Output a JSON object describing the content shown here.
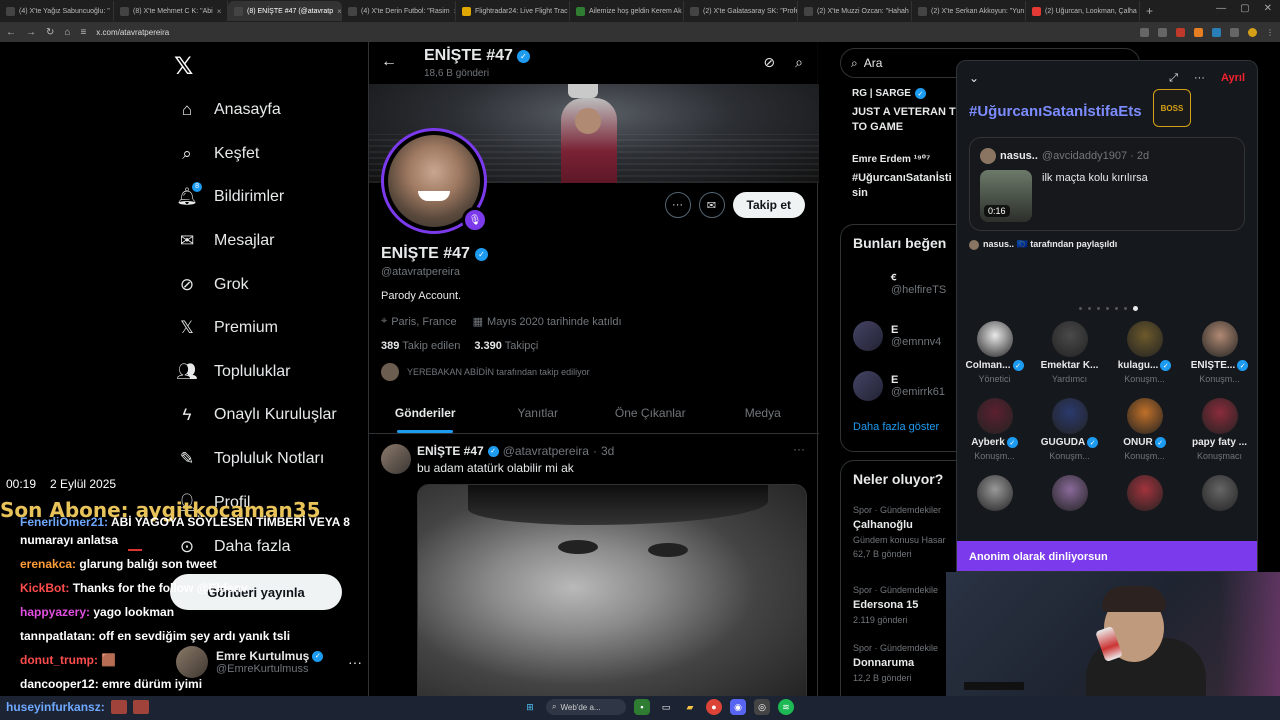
{
  "browser": {
    "tabs": [
      {
        "label": "(4) X'te Yağız Sabuncuoğlu: \"",
        "color": "#444"
      },
      {
        "label": "(8) X'te Mehmet C K: \"Abi",
        "color": "#444"
      },
      {
        "label": "(8) ENİŞTE #47 (@atavratp",
        "color": "#444",
        "active": true
      },
      {
        "label": "(4) X'te Derin Futbol: \"Rasim",
        "color": "#444"
      },
      {
        "label": "Flightradar24: Live Flight Trac",
        "color": "#e0a800"
      },
      {
        "label": "Ailemize hoş geldin Kerem Ak",
        "color": "#2e7d32"
      },
      {
        "label": "(2) X'te Galatasaray SK: \"Profe",
        "color": "#444"
      },
      {
        "label": "(2) X'te Muzzi Ozcan: \"Hahah",
        "color": "#444"
      },
      {
        "label": "(2) X'te Serkan Akkoyun: \"Yun",
        "color": "#444"
      },
      {
        "label": "(2) Uğurcan, Lookman, Çalha",
        "color": "#e53935"
      }
    ],
    "url": "x.com/atavratpereira"
  },
  "nav": {
    "items": [
      {
        "label": "Anasayfa",
        "icon": "home-icon"
      },
      {
        "label": "Keşfet",
        "icon": "search-icon"
      },
      {
        "label": "Bildirimler",
        "icon": "bell-icon",
        "badge": "8"
      },
      {
        "label": "Mesajlar",
        "icon": "mail-icon"
      },
      {
        "label": "Grok",
        "icon": "grok-icon"
      },
      {
        "label": "Premium",
        "icon": "x-icon"
      },
      {
        "label": "Topluluklar",
        "icon": "people-icon"
      },
      {
        "label": "Onaylı Kuruluşlar",
        "icon": "bolt-icon"
      },
      {
        "label": "Topluluk Notları",
        "icon": "notes-icon"
      },
      {
        "label": "Profil",
        "icon": "user-icon"
      },
      {
        "label": "Daha fazla",
        "icon": "more-circle-icon"
      }
    ],
    "post_button": "Gönderi yayınla",
    "account": {
      "name": "Emre Kurtulmuş",
      "handle": "@EmreKurtulmuss"
    }
  },
  "profile": {
    "header_name": "ENİŞTE #47",
    "post_count": "18,6 B gönderi",
    "name": "ENİŞTE #47",
    "handle": "@atavratpereira",
    "bio": "Parody Account.",
    "location": "Paris, France",
    "joined": "Mayıs 2020 tarihinde katıldı",
    "following_count": "389",
    "following_label": "Takip edilen",
    "followers_count": "3.390",
    "followers_label": "Takipçi",
    "followed_by": "YEREBAKAN ABİDİN tarafından takip ediliyor",
    "follow_button": "Takip et",
    "tabs": [
      "Gönderiler",
      "Yanıtlar",
      "Öne Çıkanlar",
      "Medya"
    ]
  },
  "tweet": {
    "name": "ENİŞTE #47",
    "handle": "@atavratpereira",
    "time": "3d",
    "text": "bu adam atatürk olabilir mi ak"
  },
  "right": {
    "search_placeholder": "Ara",
    "post1": {
      "author": "RG | SARGE",
      "text": "JUST A VETERAN TI",
      "text2": "TO GAME"
    },
    "post2": {
      "author": "Emre Erdem ¹⁹⁰⁷",
      "text": "#UğurcanıSatanİsti",
      "text2": "sin"
    },
    "suggest_title": "Bunları beğen",
    "suggestions": [
      {
        "name": "ꞓ",
        "handle": "@helfireTS"
      },
      {
        "name": "E",
        "handle": "@emnnv4"
      },
      {
        "name": "E",
        "handle": "@emirrk61"
      }
    ],
    "show_more": "Daha fazla göster",
    "trends_title": "Neler oluyor?",
    "trends": [
      {
        "category": "Spor · Gündemdekiler",
        "title": "Çalhanoğlu",
        "count": "Gündem konusu  Hasar",
        "count2": "62,7 B gönderi"
      },
      {
        "category": "Spor · Gündemdekile",
        "title": "Edersona 15",
        "count": "2.119 gönderi"
      },
      {
        "category": "Spor · Gündemdekile",
        "title": "Donnaruma",
        "count": "12,2 B gönderi"
      }
    ]
  },
  "space": {
    "leave": "Ayrıl",
    "title": "#UğurcanıSatanİstifaEts",
    "boss_logo": "BOSS",
    "card": {
      "name": "nasus..",
      "handle": "@avcidaddy1907 · 2d",
      "text": "ilk maçta kolu kırılırsa",
      "duration": "0:16"
    },
    "shared_by": "nasus.. 🇪🇺 tarafından paylaşıldı",
    "speakers": [
      {
        "name": "Colman...",
        "role": "Yönetici",
        "color": "#e8e8e8",
        "verified": true
      },
      {
        "name": "Emektar K...",
        "role": "Yardımcı",
        "color": "#4a4a4a",
        "verified": false
      },
      {
        "name": "kulagu...",
        "role": "Konuşm...",
        "color": "#6d5a2b",
        "verified": true
      },
      {
        "name": "ENİŞTE...",
        "role": "Konuşm...",
        "color": "#b08a73",
        "verified": true
      },
      {
        "name": "Ayberk",
        "role": "Konuşm...",
        "color": "#5c2030",
        "verified": true
      },
      {
        "name": "GUGUDA",
        "role": "Konuşm...",
        "color": "#2b3a6e",
        "verified": true
      },
      {
        "name": "ONUR",
        "role": "Konuşm...",
        "color": "#c07028",
        "verified": true
      },
      {
        "name": "papy faty ...",
        "role": "Konuşmacı",
        "color": "#8b2b3b",
        "verified": false
      },
      {
        "name": "",
        "role": "",
        "color": "#999",
        "verified": false
      },
      {
        "name": "",
        "role": "",
        "color": "#8a6a9a",
        "verified": false
      },
      {
        "name": "",
        "role": "",
        "color": "#a3333d",
        "verified": false
      },
      {
        "name": "",
        "role": "",
        "color": "#666",
        "verified": false
      }
    ],
    "banner": "Anonim olarak dinliyorsun"
  },
  "overlay": {
    "time": "00:19",
    "date": "2 Eylül 2025",
    "last_sub": "Son Abone: aygitkocaman35",
    "chat": [
      {
        "user": "FenerliOmer21:",
        "color": "#6fa8ff",
        "text": "ABİ YAGOYA SÖYLESEN TİMBERİ VEYA 8"
      },
      {
        "user": "",
        "color": "#fff",
        "text": "numarayı anlatsa"
      },
      {
        "user": "erenakca:",
        "color": "#ff9d3a",
        "text": "glarung balığı son tweet"
      },
      {
        "user": "KickBot:",
        "color": "#ff4d4d",
        "text": "Thanks for the follow @Eldenv"
      },
      {
        "user": "happyazery:",
        "color": "#e04fe0",
        "text": "yago lookman"
      },
      {
        "user": "tannpatlatan:",
        "color": "#fff",
        "text": "off en sevdiğim şey ardı yanık tsli"
      },
      {
        "user": "donut_trump:",
        "color": "#ff4d4d",
        "text": "🟫"
      },
      {
        "user": "dancooper12:",
        "color": "#fff",
        "text": "emre dürüm iyimi"
      }
    ],
    "bottom_user": "huseyinfurkansz:"
  },
  "taskbar": {
    "search": "Web'de a..."
  }
}
